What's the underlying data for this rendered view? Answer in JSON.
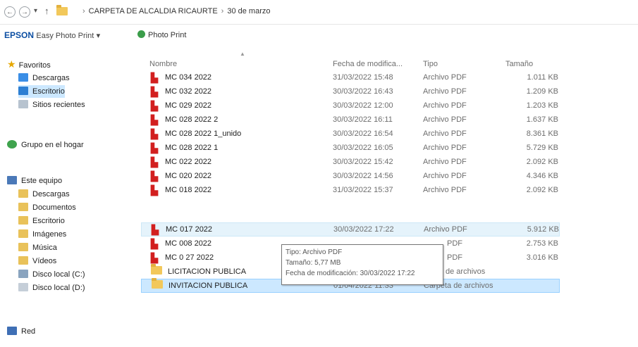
{
  "address": {
    "back": "←",
    "forward": "→",
    "dropdown": "▾",
    "up": "↑",
    "chevron": "›",
    "path": [
      "CARPETA DE ALCALDIA RICAURTE",
      "30 de marzo"
    ]
  },
  "toolbar": {
    "brand": "EPSON",
    "app": "Easy Photo Print",
    "dropdown": "▾",
    "photo_print": "Photo Print"
  },
  "sidebar": {
    "favorites": "Favoritos",
    "fav_items": [
      "Descargas",
      "Escritorio",
      "Sitios recientes"
    ],
    "homegroup": "Grupo en el hogar",
    "this_pc": "Este equipo",
    "pc_items": [
      "Descargas",
      "Documentos",
      "Escritorio",
      "Imágenes",
      "Música",
      "Vídeos",
      "Disco local (C:)",
      "Disco local (D:)"
    ],
    "network": "Red"
  },
  "columns": {
    "name": "Nombre",
    "date": "Fecha de modifica...",
    "type": "Tipo",
    "size": "Tamaño"
  },
  "files": [
    {
      "name": "MC 034 2022",
      "date": "31/03/2022 15:48",
      "type": "Archivo PDF",
      "size": "1.011 KB"
    },
    {
      "name": "MC 032 2022",
      "date": "30/03/2022 16:43",
      "type": "Archivo PDF",
      "size": "1.209 KB"
    },
    {
      "name": "MC 029 2022",
      "date": "30/03/2022 12:00",
      "type": "Archivo PDF",
      "size": "1.203 KB"
    },
    {
      "name": "MC 028 2022 2",
      "date": "30/03/2022 16:11",
      "type": "Archivo PDF",
      "size": "1.637 KB"
    },
    {
      "name": "MC 028 2022 1_unido",
      "date": "30/03/2022 16:54",
      "type": "Archivo PDF",
      "size": "8.361 KB"
    },
    {
      "name": "MC 028 2022 1",
      "date": "30/03/2022 16:05",
      "type": "Archivo PDF",
      "size": "5.729 KB"
    },
    {
      "name": "MC 022 2022",
      "date": "30/03/2022 15:42",
      "type": "Archivo PDF",
      "size": "2.092 KB"
    },
    {
      "name": "MC 020 2022",
      "date": "30/03/2022 14:56",
      "type": "Archivo PDF",
      "size": "4.346 KB"
    },
    {
      "name": "MC 018 2022",
      "date": "31/03/2022 15:37",
      "type": "Archivo PDF",
      "size": "2.092 KB"
    },
    {
      "name": "MC 017 2022",
      "date": "30/03/2022 17:22",
      "type": "Archivo PDF",
      "size": "5.912 KB"
    },
    {
      "name": "MC 008 2022",
      "date": "",
      "type": "PDF",
      "size": "2.753 KB"
    },
    {
      "name": "MC 0 27 2022",
      "date": "",
      "type": "PDF",
      "size": "3.016 KB"
    },
    {
      "name": "LICITACION PUBLICA",
      "date": "",
      "type": "de archivos",
      "size": ""
    },
    {
      "name": "INVITACION PUBLICA",
      "date": "01/04/2022 11:33",
      "type": "Carpeta de archivos",
      "size": ""
    }
  ],
  "tooltip": {
    "line1": "Tipo: Archivo PDF",
    "line2": "Tamaño: 5,77 MB",
    "line3": "Fecha de modificación: 30/03/2022 17:22"
  },
  "colors": {
    "selection": "#cce8ff",
    "hover": "#e5f3fb",
    "pdf_red": "#d21f1f",
    "folder_yellow": "#f2c85b"
  }
}
